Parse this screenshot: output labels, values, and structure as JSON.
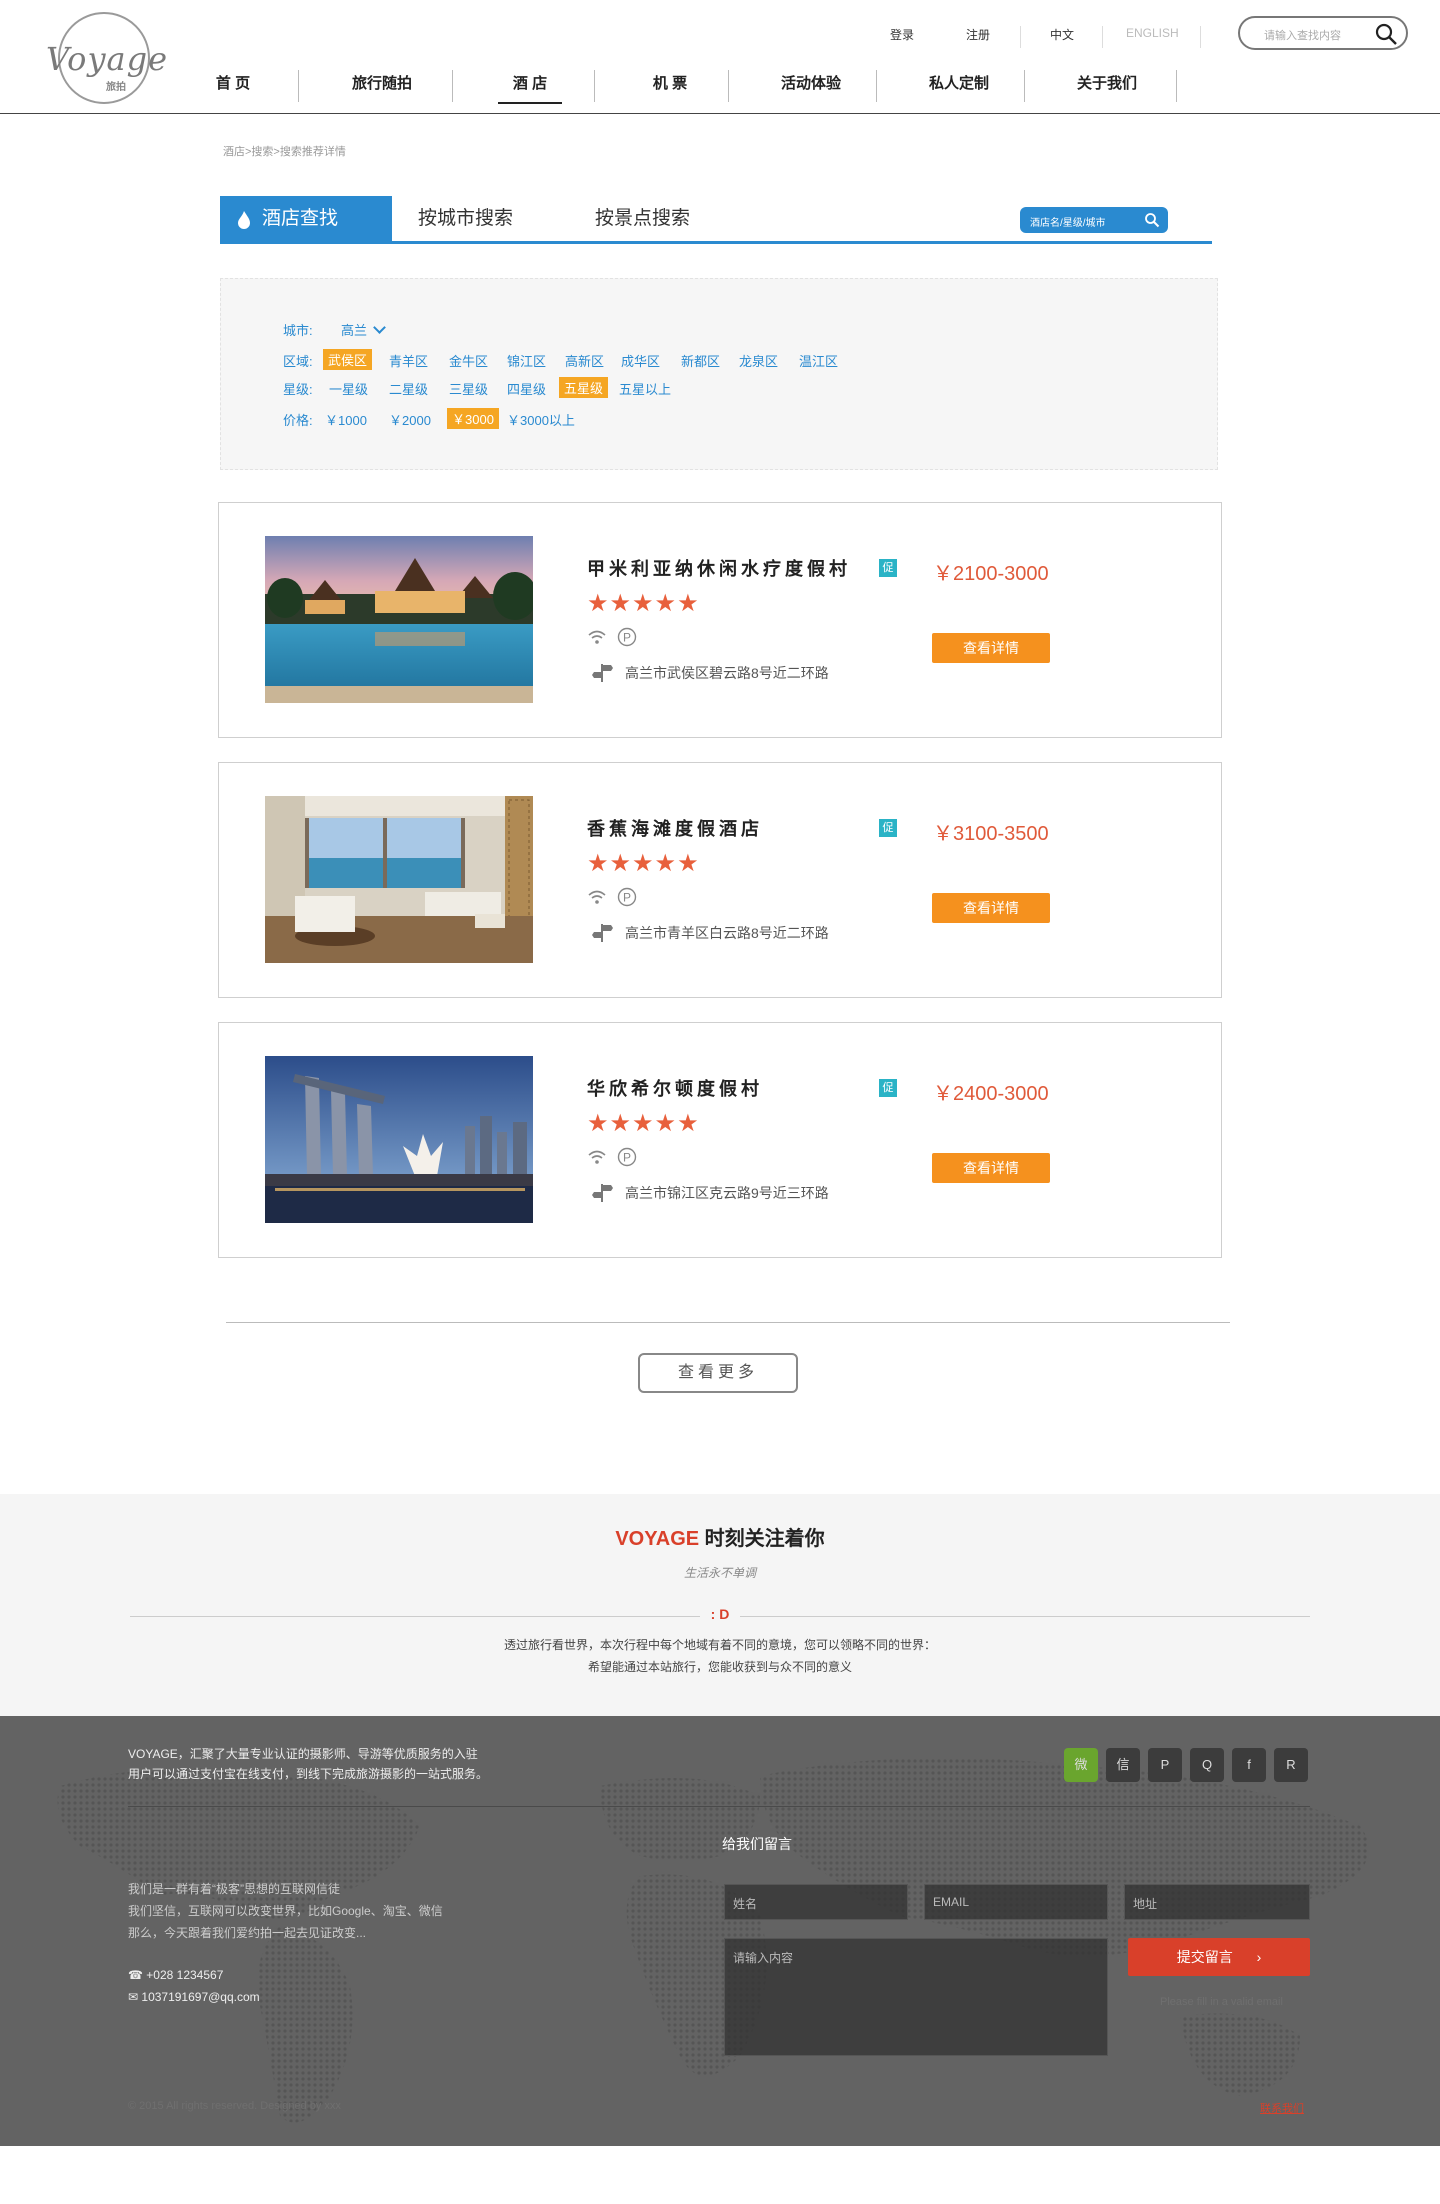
{
  "header": {
    "logo": {
      "word": "Voyage",
      "sub": "旅拍"
    },
    "top_links": {
      "login": "登录",
      "register": "注册",
      "lang_cn": "中文",
      "lang_en": "ENGLISH"
    },
    "search_placeholder": "请输入查找内容",
    "nav": [
      {
        "label": "首 页"
      },
      {
        "label": "旅行随拍"
      },
      {
        "label": "酒 店"
      },
      {
        "label": "机 票"
      },
      {
        "label": "活动体验"
      },
      {
        "label": "私人定制"
      },
      {
        "label": "关于我们"
      }
    ]
  },
  "breadcrumb": "酒店>搜索>搜索推荐详情",
  "search_tabs": {
    "tabs": [
      "酒店查找",
      "按城市搜索",
      "按景点搜索"
    ],
    "search_placeholder": "酒店名/星级/城市"
  },
  "filter": {
    "city_label": "城市:",
    "city_value": "高兰",
    "district_label": "区域:",
    "districts": [
      "武侯区",
      "青羊区",
      "金牛区",
      "锦江区",
      "高新区",
      "成华区",
      "新都区",
      "龙泉区",
      "温江区"
    ],
    "star_label": "星级:",
    "stars": [
      "一星级",
      "二星级",
      "三星级",
      "四星级",
      "五星级",
      "五星以上"
    ],
    "price_label": "价格:",
    "prices": [
      "￥1000",
      "￥2000",
      "￥3000",
      "￥3000以上"
    ]
  },
  "hotels": [
    {
      "name": "甲米利亚纳休闲水疗度假村",
      "promo": "促",
      "stars": "★★★★★",
      "address": "高兰市武侯区碧云路8号近二环路",
      "price": "￥2100-3000",
      "button": "查看详情"
    },
    {
      "name": "香蕉海滩度假酒店",
      "promo": "促",
      "stars": "★★★★★",
      "address": "高兰市青羊区白云路8号近二环路",
      "price": "￥3100-3500",
      "button": "查看详情"
    },
    {
      "name": "华欣希尔顿度假村",
      "promo": "促",
      "stars": "★★★★★",
      "address": "高兰市锦江区克云路9号近三环路",
      "price": "￥2400-3000",
      "button": "查看详情"
    }
  ],
  "more_button": "查看更多",
  "follow": {
    "brand": "VOYAGE",
    "title": "时刻关注着你",
    "subtitle": "生活永不单调",
    "mark": ": D",
    "desc_line1": "透过旅行看世界，本次行程中每个地域有着不同的意境，您可以领略不同的世界：",
    "desc_line2": "希望能通过本站旅行，您能收获到与众不同的意义"
  },
  "footer": {
    "about_line1": "VOYAGE，汇聚了大量专业认证的摄影师、导游等优质服务的入驻",
    "about_line2": "用户可以通过支付宝在线支付，到线下完成旅游摄影的一站式服务。",
    "social": [
      "weibo-icon",
      "wechat-icon",
      "pinterest-icon",
      "qq-icon",
      "facebook-icon",
      "rss-icon"
    ],
    "social_glyphs": [
      "微",
      "信",
      "P",
      "Q",
      "f",
      "R"
    ],
    "form_title": "给我们留言",
    "info_line1": "我们是一群有着“极客”思想的互联网信徒",
    "info_line2": "我们坚信，互联网可以改变世界，比如Google、淘宝、微信",
    "info_line3": "那么，今天跟着我们爱约拍一起去见证改变...",
    "phone": "+028 1234567",
    "email": "1037191697@qq.com",
    "name_placeholder": "姓名",
    "email_placeholder": "EMAIL",
    "address_placeholder": "地址",
    "content_placeholder": "请输入内容",
    "submit": "提交留言",
    "copyright": "© 2015 All rights reserved. Designed by xxx",
    "right_link": "联系我们",
    "hint": "Please fill in a valid email"
  }
}
